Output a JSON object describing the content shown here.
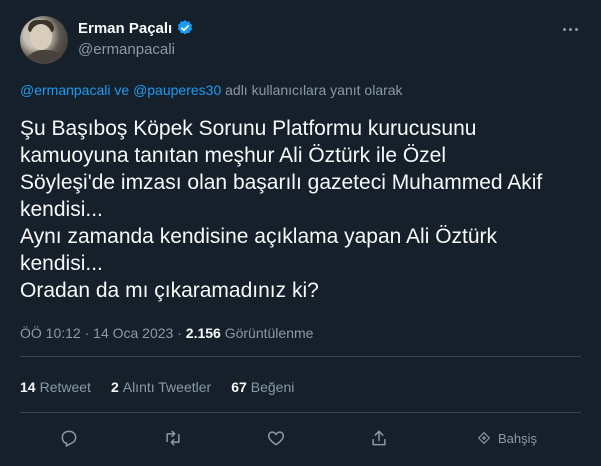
{
  "author": {
    "display_name": "Erman Paçalı",
    "handle": "@ermanpacali"
  },
  "reply": {
    "mention1": "@ermanpacali",
    "connector": "ve",
    "mention2": "@pauperes30",
    "suffix": "adlı kullanıcılara yanıt olarak"
  },
  "tweet_text": "Şu Başıboş Köpek Sorunu Platformu kurucusunu\nkamuoyuna tanıtan meşhur Ali Öztürk ile Özel\nSöyleşi'de imzası olan başarılı gazeteci Muhammed Akif\nkendisi...\nAynı zamanda kendisine açıklama yapan Ali Öztürk\nkendisi...\nOradan da mı çıkaramadınız ki?",
  "meta": {
    "time": "ÖÖ 10:12",
    "date": "14 Oca 2023",
    "views_count": "2.156",
    "views_label": "Görüntülenme",
    "separator": "·"
  },
  "stats": {
    "retweets_count": "14",
    "retweets_label": "Retweet",
    "quotes_count": "2",
    "quotes_label": "Alıntı Tweetler",
    "likes_count": "67",
    "likes_label": "Beğeni"
  },
  "actions": {
    "tip_label": "Bahşiş"
  },
  "colors": {
    "background": "#15202b",
    "accent": "#1d9bf0",
    "secondary_text": "#8b98a5",
    "divider": "#38444d"
  }
}
